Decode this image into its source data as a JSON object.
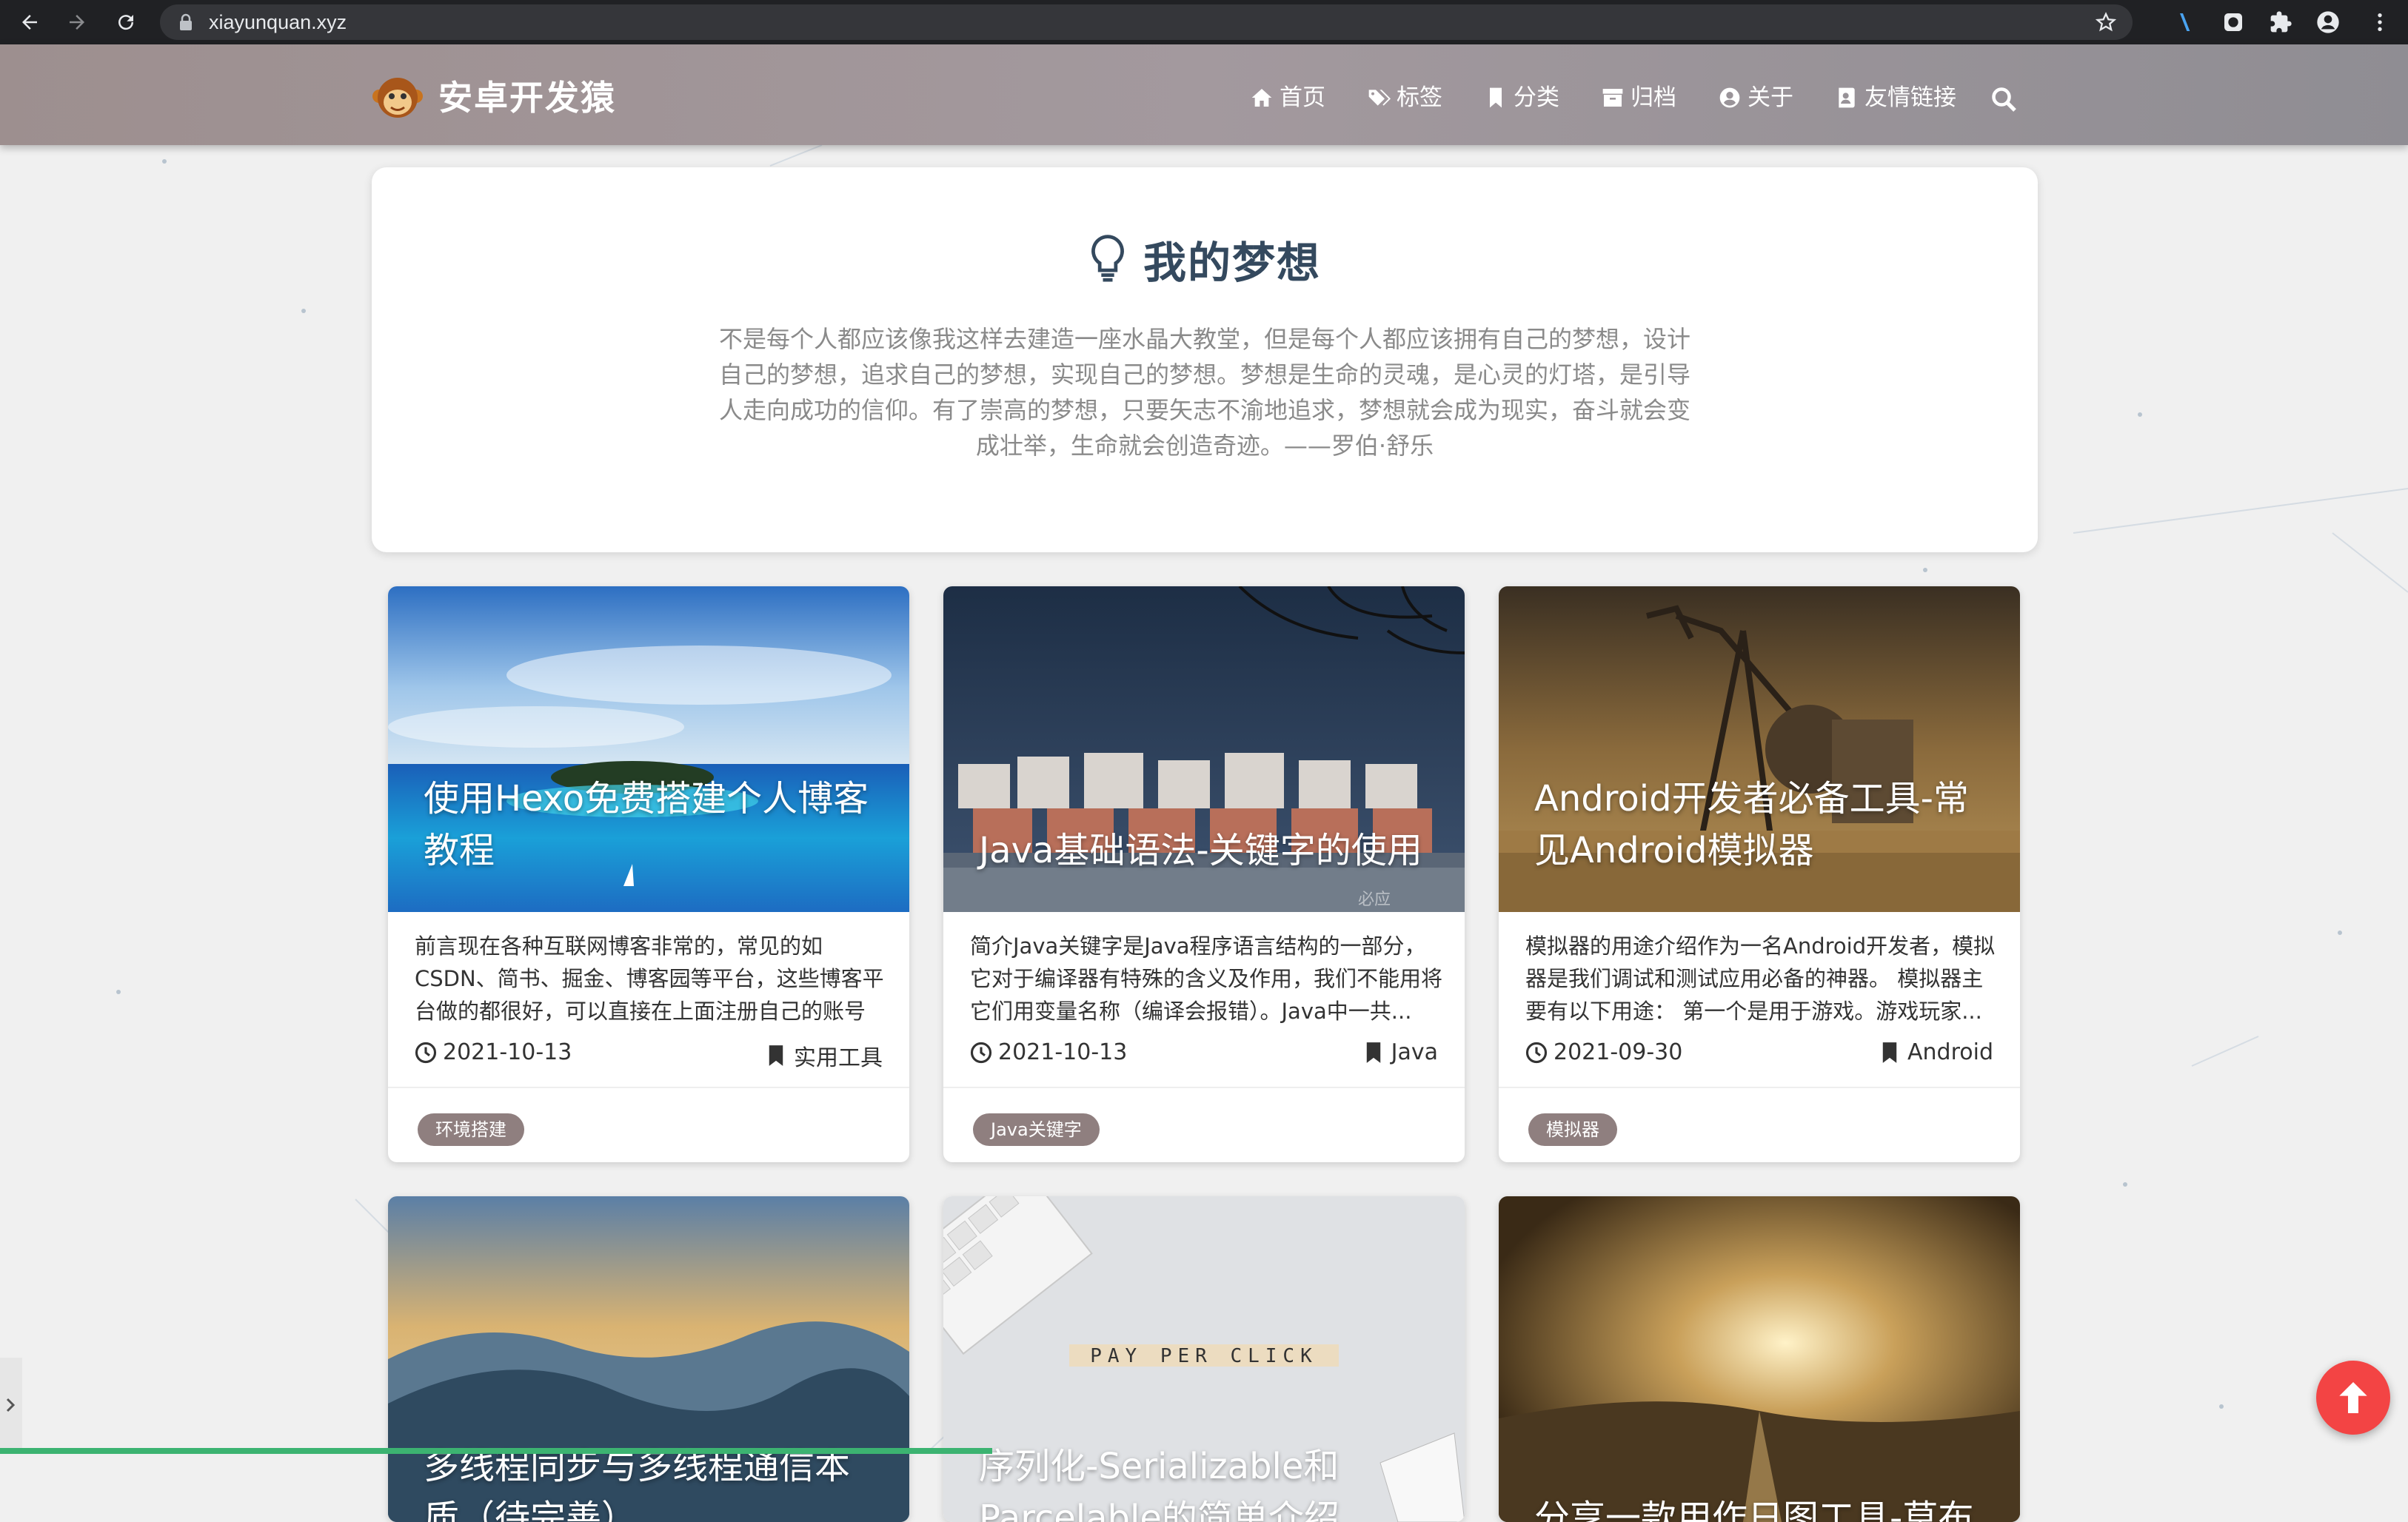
{
  "browser": {
    "url": "xiayunquan.xyz",
    "icons": [
      "back-icon",
      "forward-icon",
      "reload-icon",
      "lock-icon",
      "star-icon",
      "extension-icon",
      "profile-icon"
    ]
  },
  "site": {
    "title": "安卓开发猿",
    "nav": [
      {
        "label": "首页",
        "icon": "home-icon"
      },
      {
        "label": "标签",
        "icon": "tags-icon"
      },
      {
        "label": "分类",
        "icon": "bookmark-icon"
      },
      {
        "label": "归档",
        "icon": "archive-icon"
      },
      {
        "label": "关于",
        "icon": "user-icon"
      },
      {
        "label": "友情链接",
        "icon": "address-book-icon"
      }
    ]
  },
  "dream": {
    "title": "我的梦想",
    "text": "不是每个人都应该像我这样去建造一座水晶大教堂，但是每个人都应该拥有自己的梦想，设计自己的梦想，追求自己的梦想，实现自己的梦想。梦想是生命的灵魂，是心灵的灯塔，是引导人走向成功的信仰。有了崇高的梦想，只要矢志不渝地追求，梦想就会成为现实，奋斗就会变成壮举，生命就会创造奇迹。——罗伯·舒乐"
  },
  "posts": [
    {
      "title": "使用Hexo免费搭建个人博客教程",
      "summary": "前言现在各种互联网博客非常的，常见的如CSDN、简书、掘金、博客园等平台，这些博客平台做的都很好，可以直接在上面注册自己的账号写...",
      "date": "2021-10-13",
      "category": "实用工具",
      "tag": "环境搭建"
    },
    {
      "title": "Java基础语法-关键字的使用",
      "summary": "简介Java关键字是Java程序语言结构的一部分，它对于编译器有特殊的含义及作用，我们不能用将它们用变量名称（编译会报错）。Java中一共...",
      "date": "2021-10-13",
      "category": "Java",
      "tag": "Java关键字",
      "watermark": "必应"
    },
    {
      "title": "Android开发者必备工具-常见Android模拟器",
      "summary": "模拟器的用途介绍作为一名Android开发者，模拟器是我们调试和测试应用必备的神器。 模拟器主要有以下用途： 第一个是用于游戏。游戏玩家...",
      "date": "2021-09-30",
      "category": "Android",
      "tag": "模拟器"
    },
    {
      "title": "多线程同步与多线程通信本质（待完善）"
    },
    {
      "title": "序列化-Serializable和Parcelable的简单介绍",
      "image_text": "PAY PER CLICK"
    },
    {
      "title": "分享一款用作日图工具-草布"
    }
  ]
}
